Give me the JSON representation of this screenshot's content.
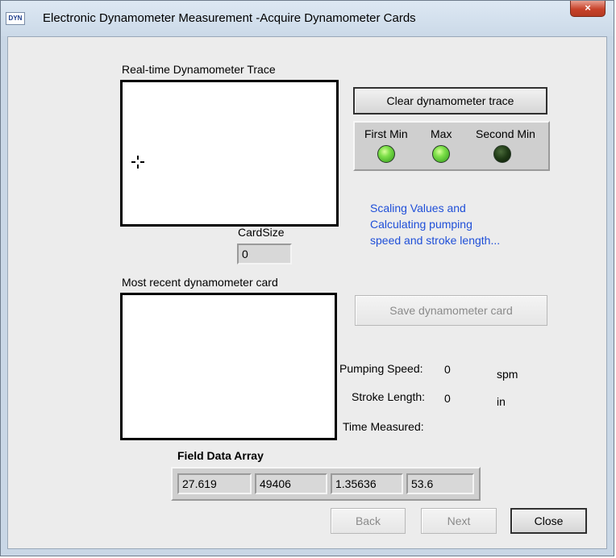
{
  "window": {
    "icon_text": "DYN",
    "title": "Electronic Dynamometer Measurement -Acquire Dynamometer Cards",
    "close_glyph": "×"
  },
  "realtime_trace": {
    "label": "Real-time Dynamometer Trace"
  },
  "clear_button": {
    "label": "Clear dynamometer trace"
  },
  "indicators": [
    {
      "label": "First Min",
      "state": "on",
      "color": "#7ee04a"
    },
    {
      "label": "Max",
      "state": "on",
      "color": "#7ee04a"
    },
    {
      "label": "Second Min",
      "state": "off",
      "color": "#1f3a16"
    }
  ],
  "status": {
    "lines": [
      "Scaling Values and",
      "Calculating pumping",
      "speed and stroke length..."
    ],
    "color": "#1f4fd8"
  },
  "card_size": {
    "label": "CardSize",
    "value": "0"
  },
  "recent_card": {
    "label": "Most recent dynamometer card"
  },
  "save_button": {
    "label": "Save dynamometer card"
  },
  "measurements": {
    "pumping_speed": {
      "label": "Pumping Speed:",
      "value": "0",
      "unit": "spm"
    },
    "stroke_length": {
      "label": "Stroke Length:",
      "value": "0",
      "unit": "in"
    },
    "time_measured": {
      "label": "Time Measured:",
      "value": ""
    }
  },
  "field_data": {
    "label": "Field Data Array",
    "values": [
      "27.619",
      "49406",
      "1.35636",
      "53.6"
    ]
  },
  "nav": {
    "back_label": "Back",
    "next_label": "Next",
    "close_label": "Close"
  }
}
